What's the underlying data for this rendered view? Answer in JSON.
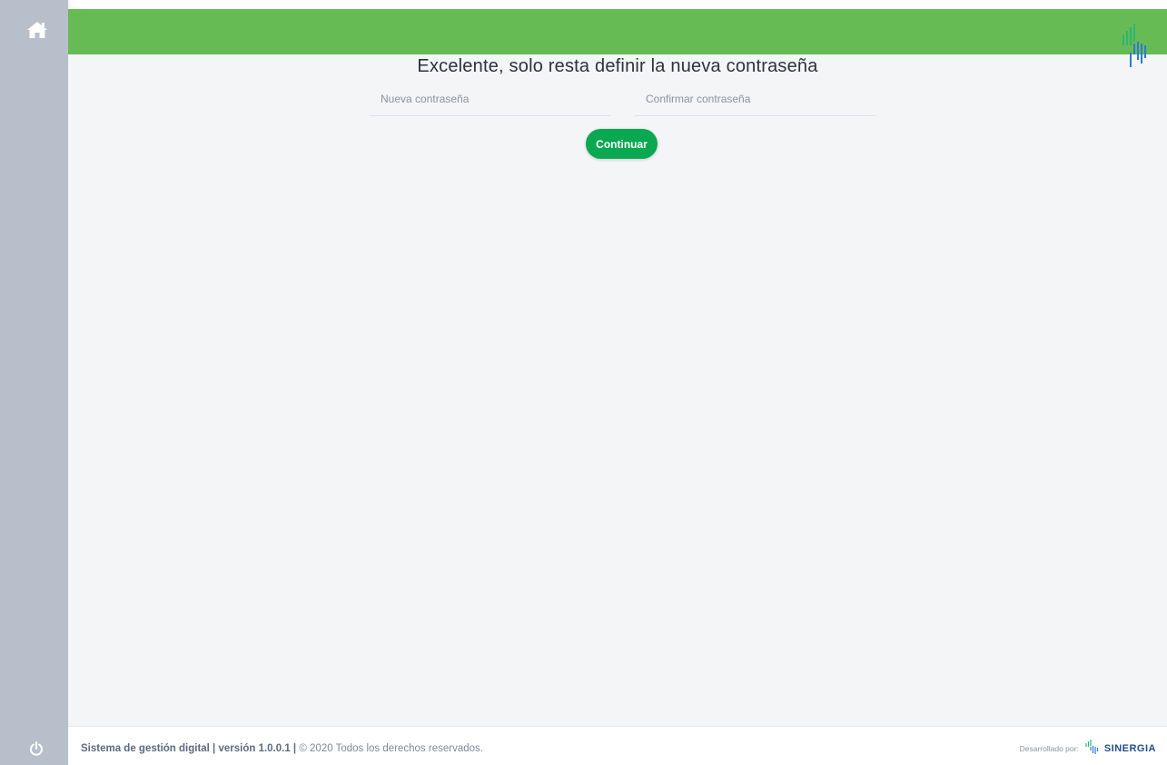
{
  "sidebar": {
    "home_icon": "home-icon",
    "power_icon": "power-icon"
  },
  "header": {
    "logo_icon": "sinergia-logo-icon",
    "accent_color": "#67bb55"
  },
  "main": {
    "title": "Excelente, solo resta definir la nueva contraseña",
    "new_password": {
      "value": "",
      "placeholder": "Nueva contraseña"
    },
    "confirm_password": {
      "value": "",
      "placeholder": "Confirmar contraseña"
    },
    "continue_label": "Continuar",
    "button_color": "#0aa851"
  },
  "footer": {
    "app_info": "Sistema de gestión digital | versión 1.0.0.1 |",
    "copyright": "© 2020 Todos los derechos reservados.",
    "developed_by_label": "Desarrollado por:",
    "developer_name": "SINERGIA"
  }
}
